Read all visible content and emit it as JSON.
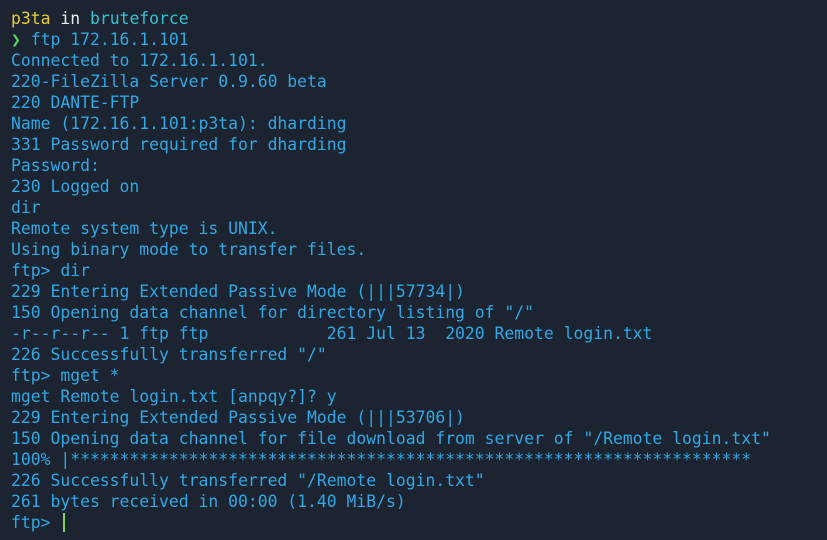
{
  "prompt": {
    "user": "p3ta",
    "in_word": " in ",
    "directory": "bruteforce",
    "symbol": "❯ "
  },
  "command": "ftp 172.16.1.101",
  "output": [
    "Connected to 172.16.1.101.",
    "220-FileZilla Server 0.9.60 beta",
    "220 DANTE-FTP",
    "Name (172.16.1.101:p3ta): dharding",
    "331 Password required for dharding",
    "Password:",
    "230 Logged on",
    "dir",
    "Remote system type is UNIX.",
    "Using binary mode to transfer files.",
    "ftp> dir",
    "229 Entering Extended Passive Mode (|||57734|)",
    "150 Opening data channel for directory listing of \"/\"",
    "-r--r--r-- 1 ftp ftp            261 Jul 13  2020 Remote login.txt",
    "226 Successfully transferred \"/\"",
    "ftp> mget *",
    "mget Remote login.txt [anpqy?]? y",
    "229 Entering Extended Passive Mode (|||53706|)",
    "150 Opening data channel for file download from server of \"/Remote login.txt\"",
    "100% |*********************************************************************",
    "226 Successfully transferred \"/Remote login.txt\"",
    "261 bytes received in 00:00 (1.40 MiB/s)"
  ],
  "final_prompt": "ftp> ",
  "colors": {
    "background": "#1b2430",
    "output": "#2fa8e6",
    "user": "#e6cc3a",
    "directory": "#33c3d4",
    "prompt_symbol": "#5fd35f",
    "cursor": "#7fd35a"
  }
}
